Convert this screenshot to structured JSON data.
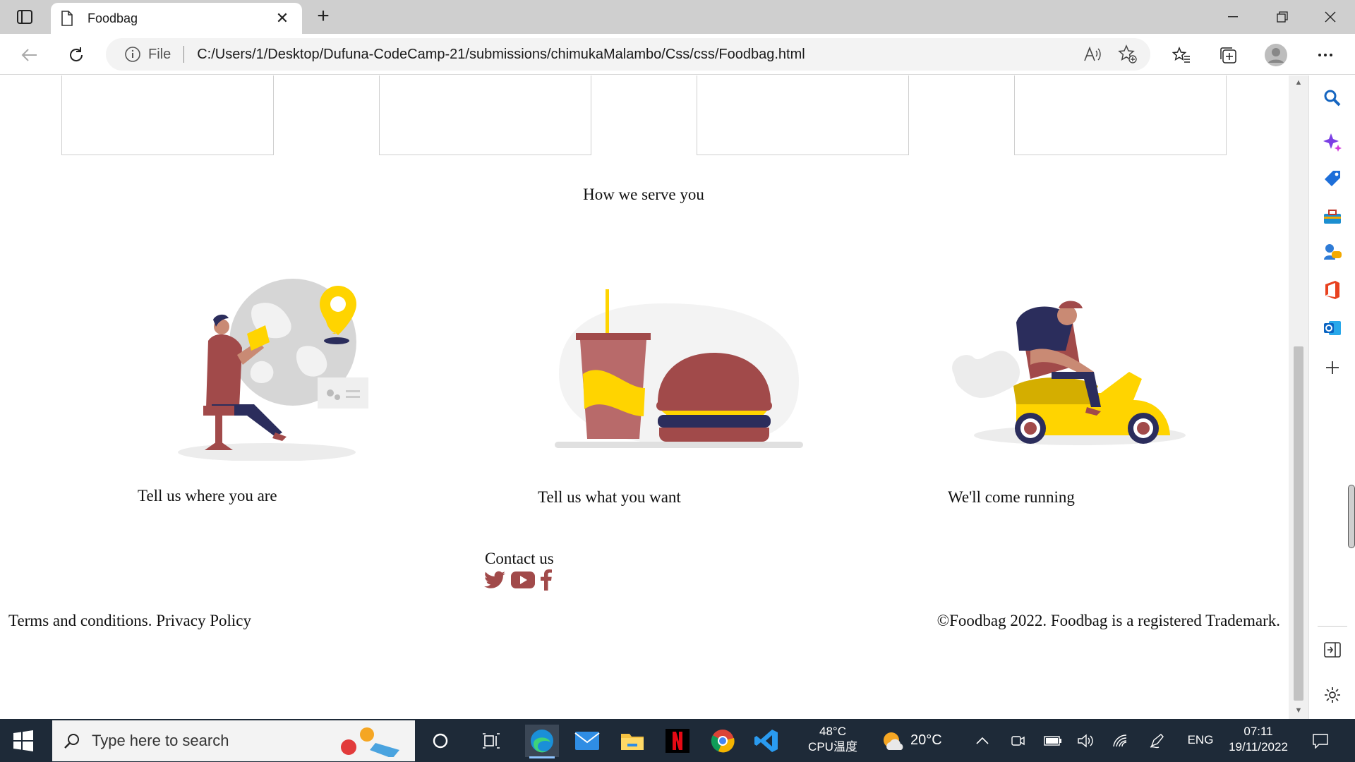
{
  "browser": {
    "tab_title": "Foodbag",
    "address_label": "File",
    "url": "C:/Users/1/Desktop/Dufuna-CodeCamp-21/submissions/chimukaMalambo/Css/css/Foodbag.html"
  },
  "page": {
    "section_title": "How we serve you",
    "steps": [
      {
        "label": "Tell us where you are",
        "icon": "location-illustration"
      },
      {
        "label": "Tell us what you want",
        "icon": "food-illustration"
      },
      {
        "label": "We'll come running",
        "icon": "delivery-scooter-illustration"
      }
    ],
    "contact_title": "Contact us",
    "social": [
      "twitter-icon",
      "youtube-icon",
      "facebook-icon"
    ],
    "footer": {
      "terms": "Terms and conditions.",
      "privacy": "Privacy Policy",
      "copyright": "©Foodbag 2022. Foodbag is a registered Trademark."
    },
    "accent_color": "#a14a4a"
  },
  "taskbar": {
    "search_placeholder": "Type here to search",
    "cpu_temp": "48°C",
    "cpu_label": "CPU温度",
    "weather_temp": "20°C",
    "language": "ENG",
    "time": "07:11",
    "date": "19/11/2022"
  }
}
